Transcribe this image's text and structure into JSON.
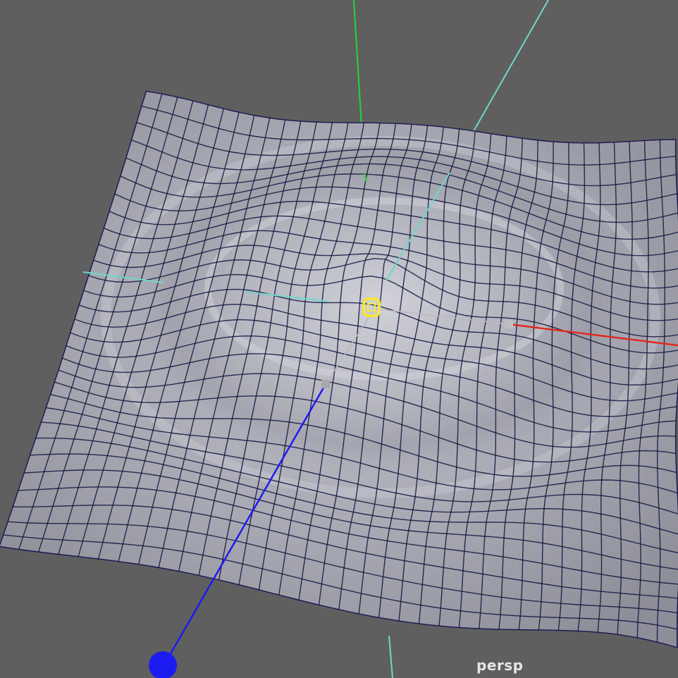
{
  "viewport": {
    "camera_name": "persp",
    "background_color": "#5f5f5f",
    "surface_color": "#a9a9b3",
    "wireframe_color": "#12123f"
  },
  "manipulator": {
    "pivot_icon": "yellow-rotate-pivot-icon",
    "handle_color_x": "#e02a1f",
    "handle_color_y": "#27d43a",
    "handle_color_z": "#1c1cf2",
    "handle_color_selected": "#6fd6c9"
  }
}
